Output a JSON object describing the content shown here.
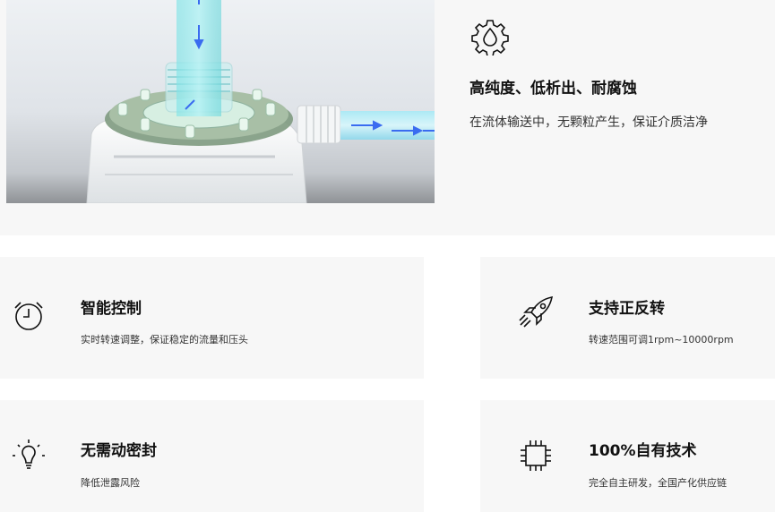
{
  "hero": {
    "icon": "gear-droplet-icon",
    "title": "高纯度、低析出、耐腐蚀",
    "description": "在流体输送中，无颗粒产生，保证介质洁净"
  },
  "features": [
    {
      "icon": "timer-icon",
      "title": "智能控制",
      "description": "实时转速调整，保证稳定的流量和压头"
    },
    {
      "icon": "rocket-icon",
      "title": "支持正反转",
      "description": "转速范围可调1rpm~10000rpm"
    },
    {
      "icon": "lightbulb-icon",
      "title": "无需动密封",
      "description": "降低泄露风险"
    },
    {
      "icon": "chip-icon",
      "title": "100%自有技术",
      "description": "完全自主研发，全国产化供应链"
    }
  ],
  "colors": {
    "panel_bg": "#f7f7f7",
    "title_text": "#111111",
    "body_text": "#333333",
    "flow_blue": "#3a6cf0",
    "fluid_cyan": "#7fe3e6"
  }
}
